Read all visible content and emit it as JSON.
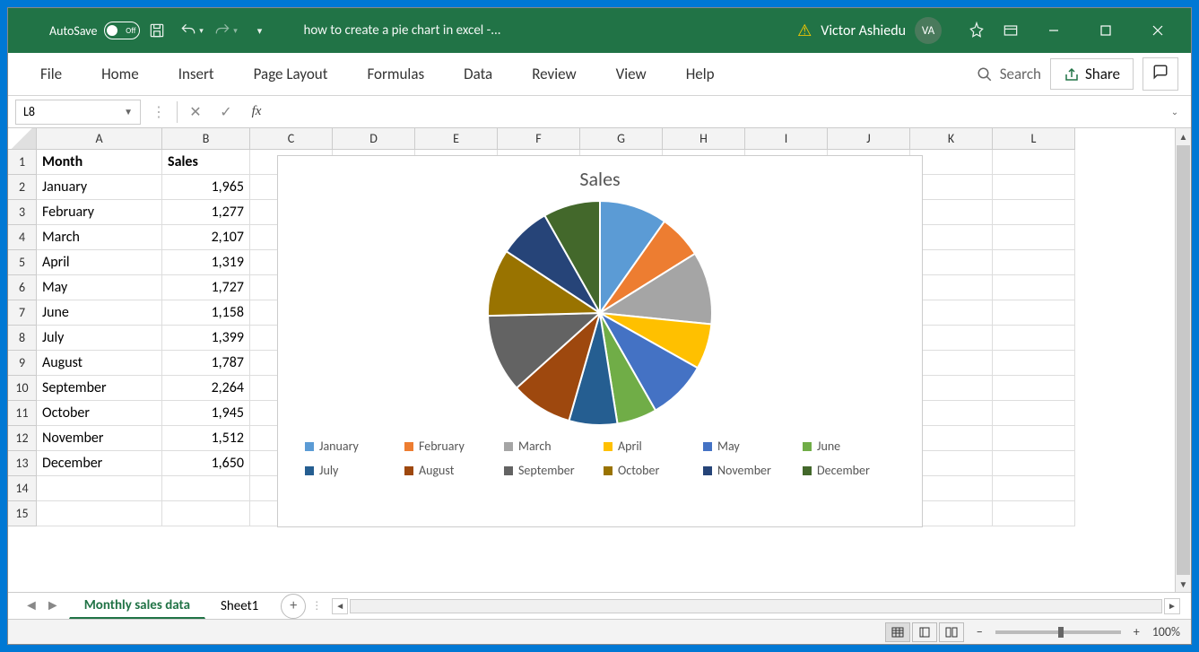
{
  "titlebar": {
    "autosave_label": "AutoSave",
    "autosave_state": "Off",
    "doc_title": "how to create a pie chart in excel  -...",
    "username": "Victor Ashiedu",
    "avatar_initials": "VA"
  },
  "ribbon": {
    "tabs": [
      "File",
      "Home",
      "Insert",
      "Page Layout",
      "Formulas",
      "Data",
      "Review",
      "View",
      "Help"
    ],
    "search_label": "Search",
    "share_label": "Share"
  },
  "formula": {
    "name_box": "L8",
    "value": ""
  },
  "columns": [
    "A",
    "B",
    "C",
    "D",
    "E",
    "F",
    "G",
    "H",
    "I",
    "J",
    "K",
    "L"
  ],
  "row_numbers": [
    "1",
    "2",
    "3",
    "4",
    "5",
    "6",
    "7",
    "8",
    "9",
    "10",
    "11",
    "12",
    "13",
    "14",
    "15"
  ],
  "table": {
    "headers": [
      "Month",
      "Sales"
    ],
    "rows": [
      [
        "January",
        "1,965"
      ],
      [
        "February",
        "1,277"
      ],
      [
        "March",
        "2,107"
      ],
      [
        "April",
        "1,319"
      ],
      [
        "May",
        "1,727"
      ],
      [
        "June",
        "1,158"
      ],
      [
        "July",
        "1,399"
      ],
      [
        "August",
        "1,787"
      ],
      [
        "September",
        "2,264"
      ],
      [
        "October",
        "1,945"
      ],
      [
        "November",
        "1,512"
      ],
      [
        "December",
        "1,650"
      ]
    ]
  },
  "chart_data": {
    "type": "pie",
    "title": "Sales",
    "categories": [
      "January",
      "February",
      "March",
      "April",
      "May",
      "June",
      "July",
      "August",
      "September",
      "October",
      "November",
      "December"
    ],
    "values": [
      1965,
      1277,
      2107,
      1319,
      1727,
      1158,
      1399,
      1787,
      2264,
      1945,
      1512,
      1650
    ],
    "colors": [
      "#5b9bd5",
      "#ed7d31",
      "#a5a5a5",
      "#ffc000",
      "#4472c4",
      "#70ad47",
      "#255e91",
      "#9e480e",
      "#636363",
      "#997300",
      "#264478",
      "#43682b"
    ]
  },
  "sheets": {
    "tabs": [
      "Monthly sales data",
      "Sheet1"
    ],
    "active": 0
  },
  "status": {
    "zoom": "100%"
  }
}
